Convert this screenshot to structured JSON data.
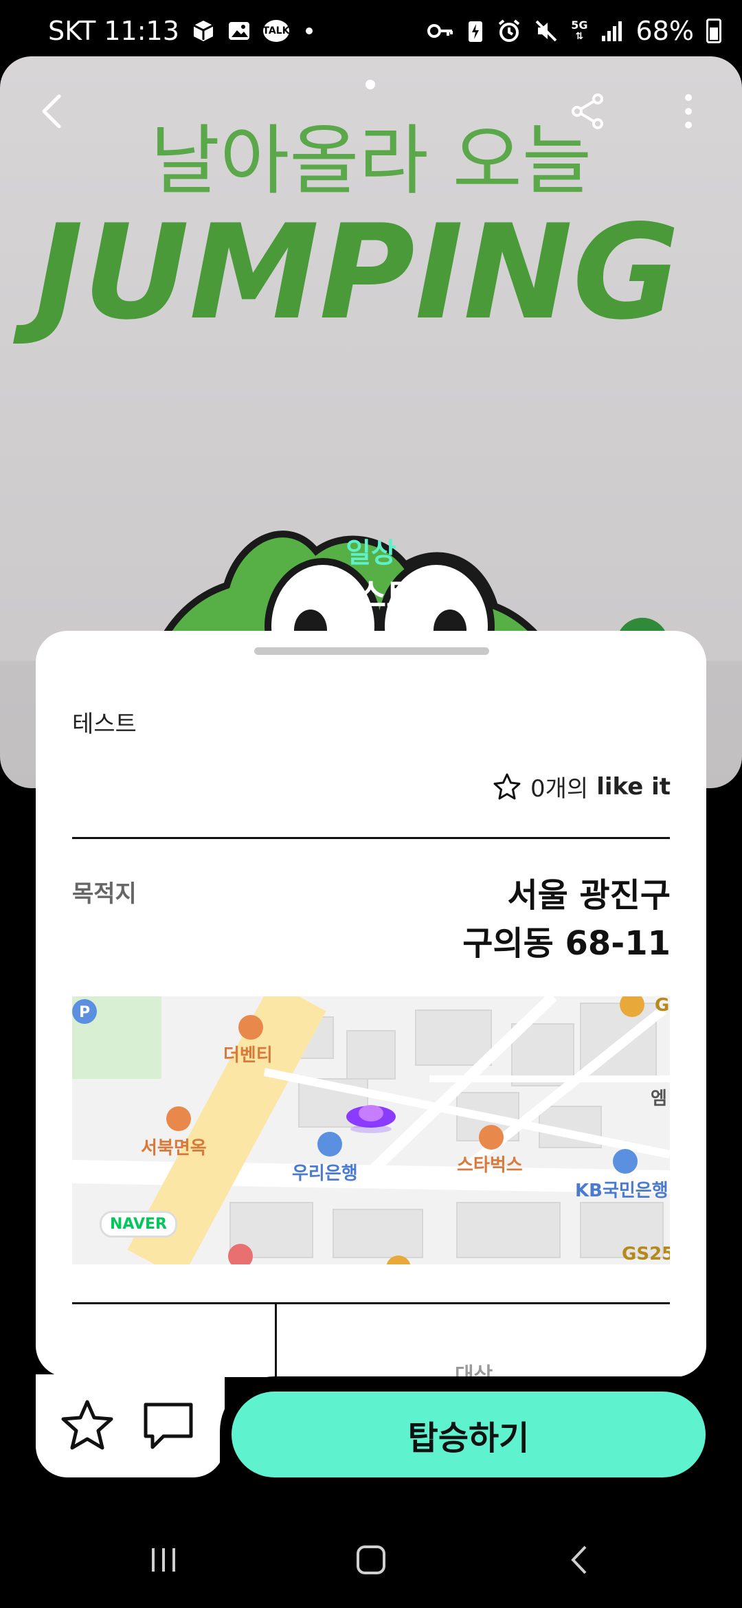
{
  "status_bar": {
    "carrier_time": "SKT 11:13",
    "talk_badge": "TALK",
    "network": "5G",
    "battery": "68%"
  },
  "hero": {
    "banner_line1": "날아올라 오늘",
    "banner_line2": "JUMPING",
    "category": "일상",
    "title": "테스트"
  },
  "sheet": {
    "description": "테스트",
    "like_count_text": "0개의",
    "like_label": "like it",
    "destination_label": "목적지",
    "destination_line1": "서울 광진구",
    "destination_line2": "구의동 68-11",
    "peek_text": "대상"
  },
  "map": {
    "labels": {
      "cafe": "더벤티",
      "restaurant": "서북면옥",
      "bank1": "우리은행",
      "starbucks": "스타벅스",
      "bank2": "KB국민은행",
      "shop": "엠",
      "gs": "GS25",
      "g": "G"
    },
    "provider": "NAVER"
  },
  "actions": {
    "ride_label": "탑승하기"
  },
  "colors": {
    "accent": "#5ef2cf",
    "map_road": "#fbe6a6",
    "naver_green": "#03c75a",
    "poi_orange": "#e8884a",
    "poi_blue": "#5b8fe0"
  }
}
